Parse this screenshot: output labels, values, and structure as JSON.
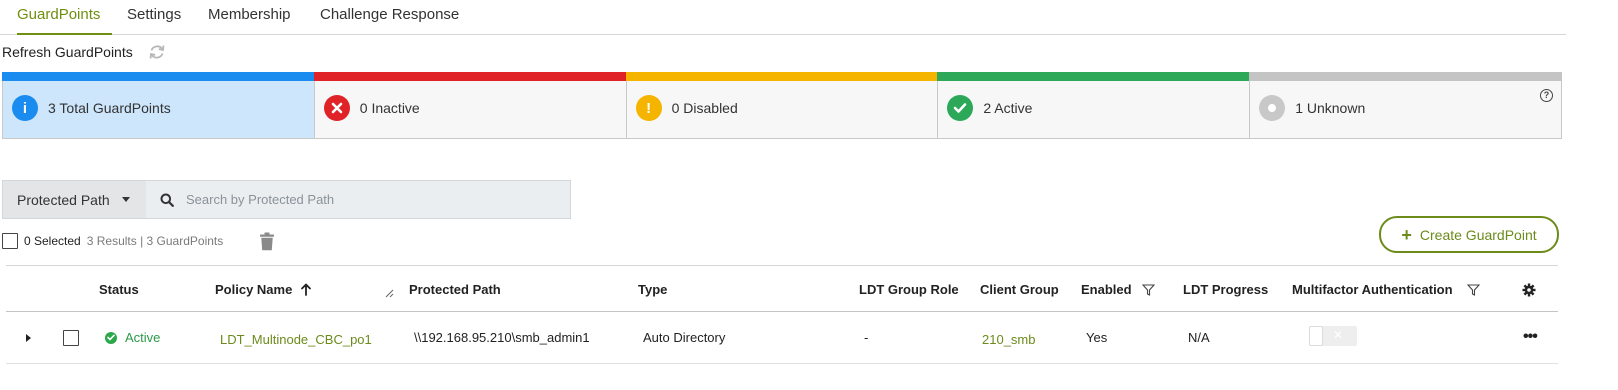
{
  "tabs": [
    {
      "label": "GuardPoints",
      "active": true
    },
    {
      "label": "Settings",
      "active": false
    },
    {
      "label": "Membership",
      "active": false
    },
    {
      "label": "Challenge Response",
      "active": false
    }
  ],
  "refresh": {
    "label": "Refresh GuardPoints",
    "icon": "refresh-icon"
  },
  "status_cards": [
    {
      "label": "3 Total GuardPoints",
      "color": "#1a8cf0",
      "icon": "info-icon",
      "selected": true
    },
    {
      "label": "0 Inactive",
      "color": "#e02327",
      "icon": "error-icon",
      "selected": false
    },
    {
      "label": "0 Disabled",
      "color": "#f5b400",
      "icon": "warning-icon",
      "selected": false
    },
    {
      "label": "2 Active",
      "color": "#2ca858",
      "icon": "check-icon",
      "selected": false
    },
    {
      "label": "1 Unknown",
      "color": "#c4c4c4",
      "icon": "unknown-icon",
      "selected": false
    }
  ],
  "search": {
    "filter_label": "Protected Path",
    "placeholder": "Search by Protected Path",
    "value": ""
  },
  "selection": {
    "selected_text": "0 Selected",
    "results_text": "3 Results | 3 GuardPoints"
  },
  "create_button": {
    "label": "Create GuardPoint"
  },
  "table": {
    "headers": {
      "status": "Status",
      "policy_name": "Policy Name",
      "protected_path": "Protected Path",
      "type": "Type",
      "ldt_group_role": "LDT Group Role",
      "client_group": "Client Group",
      "enabled": "Enabled",
      "ldt_progress": "LDT Progress",
      "mfa": "Multifactor Authentication"
    },
    "rows": [
      {
        "status": "Active",
        "policy_name": "LDT_Multinode_CBC_po1",
        "protected_path": "\\\\192.168.95.210\\smb_admin1",
        "type": "Auto Directory",
        "ldt_group_role": "-",
        "client_group": "210_smb",
        "enabled": "Yes",
        "ldt_progress": "N/A",
        "mfa_enabled": false
      }
    ]
  },
  "colors": {
    "accent": "#6b8b1b",
    "active_status": "#2b9b48",
    "selected_card_bg": "#cde6fb"
  }
}
